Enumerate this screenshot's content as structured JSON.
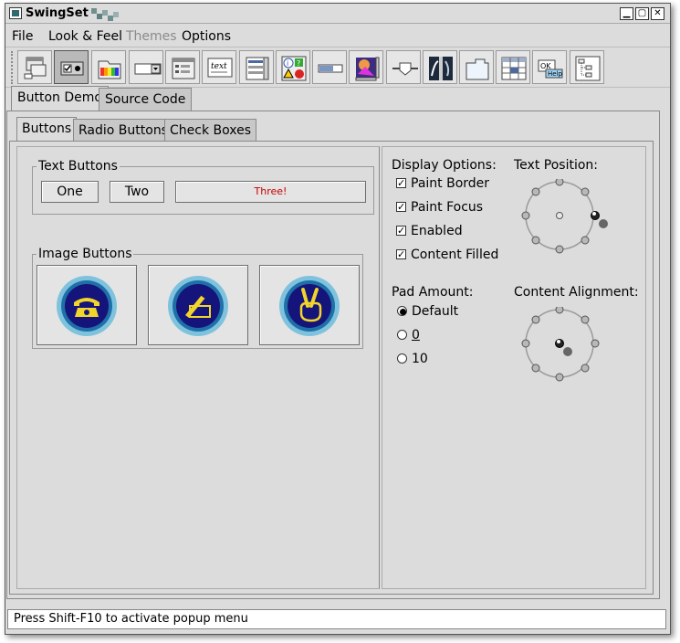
{
  "window": {
    "title": "SwingSet",
    "controls": {
      "minimize": "▁",
      "maximize": "▢",
      "close": "✕"
    }
  },
  "menubar": {
    "items": [
      {
        "label": "File",
        "enabled": true
      },
      {
        "label": "Look & Feel",
        "enabled": true
      },
      {
        "label": "Themes",
        "enabled": false
      },
      {
        "label": "Options",
        "enabled": true
      }
    ]
  },
  "toolbar": {
    "icons": [
      "internal-frame-icon",
      "button-demo-icon",
      "color-chooser-icon",
      "combobox-icon",
      "file-chooser-icon",
      "html-text-icon",
      "list-icon",
      "option-pane-icon",
      "progress-bar-icon",
      "scroll-pane-icon",
      "slider-icon",
      "split-pane-icon",
      "tabbed-pane-icon",
      "table-icon",
      "tooltip-icon",
      "tree-icon"
    ],
    "selected_index": 1,
    "tooltip_label": "OK",
    "tooltip_help": "Help"
  },
  "outer_tabs": [
    {
      "label": "Button Demo"
    },
    {
      "label": "Source Code"
    }
  ],
  "inner_tabs": [
    {
      "label": "Buttons"
    },
    {
      "label": "Radio Buttons"
    },
    {
      "label": "Check Boxes"
    }
  ],
  "text_buttons": {
    "title": "Text Buttons",
    "buttons": [
      {
        "label": "One"
      },
      {
        "label": "Two"
      },
      {
        "label": "Three!"
      }
    ],
    "three_color": "#c60000"
  },
  "image_buttons": {
    "title": "Image Buttons",
    "icons": [
      "telephone-icon",
      "pen-writing-icon",
      "peace-hand-icon"
    ]
  },
  "display_options": {
    "title": "Display Options:",
    "items": [
      {
        "label": "Paint Border",
        "checked": true
      },
      {
        "label": "Paint Focus",
        "checked": true
      },
      {
        "label": "Enabled",
        "checked": true
      },
      {
        "label": "Content Filled",
        "checked": true
      }
    ]
  },
  "pad_amount": {
    "title": "Pad Amount:",
    "options": [
      {
        "label": "Default",
        "selected": true
      },
      {
        "label": "0",
        "selected": false
      },
      {
        "label": "10",
        "selected": false
      }
    ]
  },
  "text_position": {
    "title": "Text Position:",
    "selected": "east"
  },
  "content_alignment": {
    "title": "Content Alignment:",
    "selected": "center"
  },
  "statusbar": {
    "text": "Press Shift-F10 to activate popup menu"
  }
}
